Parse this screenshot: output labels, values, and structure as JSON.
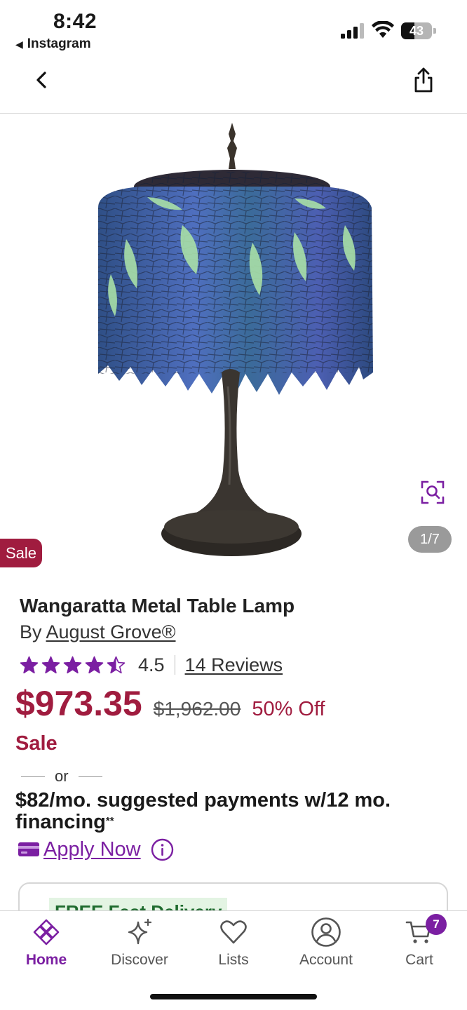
{
  "status_bar": {
    "time": "8:42",
    "back_app": "Instagram",
    "battery_level": "43",
    "battery_fraction": 0.43
  },
  "header": {
    "back_icon": "chevron-left-icon",
    "share_icon": "share-icon"
  },
  "gallery": {
    "image_counter": "1/7",
    "sale_badge": "Sale",
    "zoom_icon": "zoom-search-icon"
  },
  "product": {
    "title": "Wangaratta Metal Table Lamp",
    "by_prefix": "By",
    "brand": "August Grove®",
    "rating": "4.5",
    "rating_value": 4.5,
    "reviews": "14 Reviews",
    "price": "$973.35",
    "was_price": "$1,962.00",
    "discount": "50% Off",
    "sale_label": "Sale",
    "or_text": "or",
    "financing_text": "$82/mo. suggested payments w/12 mo. financing",
    "financing_mark": "**",
    "apply_now": "Apply Now"
  },
  "delivery": {
    "tag": "FREE Fast Delivery"
  },
  "colors": {
    "accent_purple": "#7b1fa2",
    "sale_red": "#a01c3f",
    "delivery_green": "#1f6b2f"
  },
  "bottom_nav": {
    "tabs": [
      {
        "label": "Home",
        "icon": "home-icon",
        "active": true
      },
      {
        "label": "Discover",
        "icon": "sparkle-icon",
        "active": false
      },
      {
        "label": "Lists",
        "icon": "heart-icon",
        "active": false
      },
      {
        "label": "Account",
        "icon": "account-icon",
        "active": false
      },
      {
        "label": "Cart",
        "icon": "cart-icon",
        "active": false
      }
    ],
    "cart_count": "7"
  }
}
